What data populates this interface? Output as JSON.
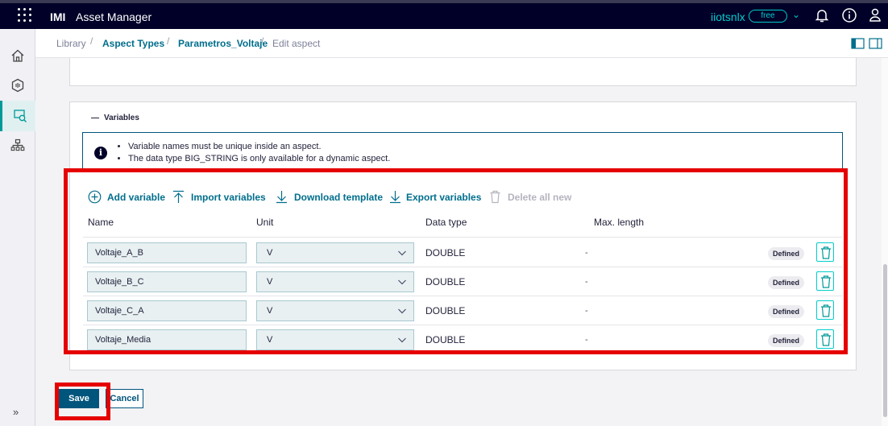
{
  "topbar": {
    "brand": "IMI",
    "app_name": "Asset Manager",
    "tenant": "iiotsnlx",
    "plan": "free",
    "icons": [
      "apps-grid-icon",
      "bell-icon",
      "info-icon",
      "user-icon"
    ]
  },
  "sidebar": {
    "items": [
      "home-icon",
      "aspects-icon",
      "asset-types-icon",
      "hierarchy-icon"
    ],
    "active": "asset-types-icon",
    "expand_label": "»"
  },
  "breadcrumb": {
    "items": [
      "Library",
      "Aspect Types",
      "Parametros_Voltaje",
      "Edit aspect"
    ],
    "separator": "/"
  },
  "variables": {
    "section_title": "Variables",
    "info_lines": [
      "Variable names must be unique inside an aspect.",
      "The data type BIG_STRING is only available for a dynamic aspect."
    ],
    "toolbar": {
      "add": "Add variable",
      "import": "Import variables",
      "download": "Download template",
      "export": "Export variables",
      "delete_all": "Delete all new"
    },
    "columns": [
      "Name",
      "Unit",
      "Data type",
      "Max. length"
    ],
    "rows": [
      {
        "name": "Voltaje_A_B",
        "unit": "V",
        "data_type": "DOUBLE",
        "max_length": "-",
        "status": "Defined"
      },
      {
        "name": "Voltaje_B_C",
        "unit": "V",
        "data_type": "DOUBLE",
        "max_length": "-",
        "status": "Defined"
      },
      {
        "name": "Voltaje_C_A",
        "unit": "V",
        "data_type": "DOUBLE",
        "max_length": "-",
        "status": "Defined"
      },
      {
        "name": "Voltaje_Media",
        "unit": "V",
        "data_type": "DOUBLE",
        "max_length": "-",
        "status": "Defined"
      }
    ]
  },
  "actions": {
    "save": "Save",
    "cancel": "Cancel"
  },
  "colors": {
    "topbar_bg": "#000028",
    "accent_teal": "#00cccc",
    "link": "#006e8c",
    "primary_button": "#00557c",
    "highlight_red": "#e60000"
  }
}
